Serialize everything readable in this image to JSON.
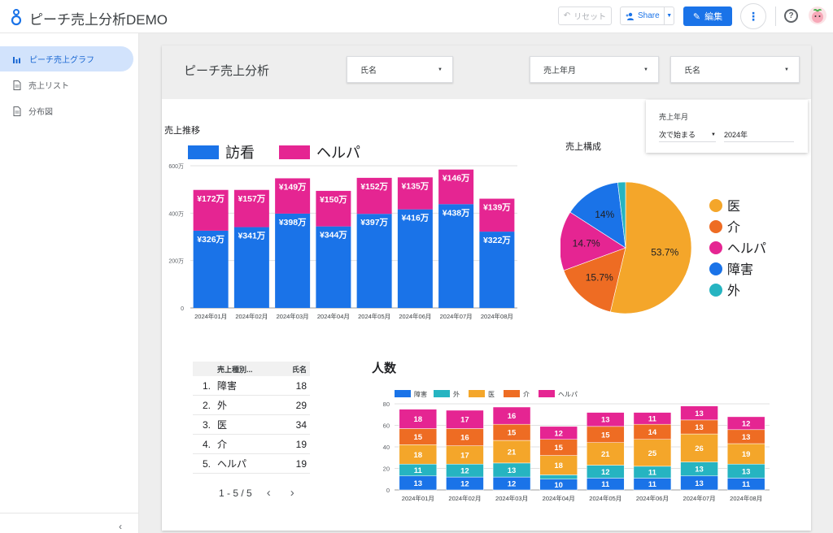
{
  "app": {
    "title": "ピーチ売上分析DEMO",
    "reset_label": "リセット",
    "share_label": "Share",
    "edit_label": "編集",
    "more_label": "⋮",
    "help_label": "?"
  },
  "sidebar": {
    "items": [
      {
        "label": "ピーチ売上グラフ",
        "active": true,
        "icon": "bar-chart-icon"
      },
      {
        "label": "売上リスト",
        "active": false,
        "icon": "document-icon"
      },
      {
        "label": "分布図",
        "active": false,
        "icon": "document-icon"
      }
    ],
    "collapse_label": "‹"
  },
  "report": {
    "title": "ピーチ売上分析",
    "filters": [
      {
        "label": "氏名"
      },
      {
        "label": "売上年月"
      },
      {
        "label": "氏名"
      }
    ],
    "date_popup": {
      "label": "売上年月",
      "mode": "次で始まる",
      "value": "2024年"
    }
  },
  "colors": {
    "houkan": "#1a73e8",
    "helper": "#e52592",
    "i": "#f4a62a",
    "kai": "#ee6c23",
    "shogai": "#1a73e8",
    "soto": "#26b4c1"
  },
  "chart_data": [
    {
      "type": "bar",
      "stacked": true,
      "title": "売上推移",
      "categories": [
        "2024年01月",
        "2024年02月",
        "2024年03月",
        "2024年04月",
        "2024年05月",
        "2024年06月",
        "2024年07月",
        "2024年08月"
      ],
      "series": [
        {
          "name": "訪看",
          "values": [
            326,
            341,
            398,
            344,
            397,
            416,
            438,
            322
          ],
          "labels": [
            "¥326万",
            "¥341万",
            "¥398万",
            "¥344万",
            "¥397万",
            "¥416万",
            "¥438万",
            "¥322万"
          ],
          "color": "#1a73e8"
        },
        {
          "name": "ヘルパ",
          "values": [
            172,
            157,
            149,
            150,
            152,
            135,
            146,
            139
          ],
          "labels": [
            "¥172万",
            "¥157万",
            "¥149万",
            "¥150万",
            "¥152万",
            "¥135万",
            "¥146万",
            "¥139万"
          ],
          "color": "#e52592"
        }
      ],
      "yticks": [
        "0",
        "200万",
        "400万",
        "600万"
      ],
      "ytick_values": [
        0,
        200,
        400,
        600
      ],
      "ylim": [
        0,
        600
      ],
      "legend": "top-left"
    },
    {
      "type": "pie",
      "title": "売上構成",
      "slices": [
        {
          "name": "医",
          "value": 53.7,
          "label": "53.7%",
          "color": "#f4a62a"
        },
        {
          "name": "介",
          "value": 15.7,
          "label": "15.7%",
          "color": "#ee6c23"
        },
        {
          "name": "ヘルパ",
          "value": 14.7,
          "label": "14.7%",
          "color": "#e52592"
        },
        {
          "name": "障害",
          "value": 14.0,
          "label": "14%",
          "color": "#1a73e8"
        },
        {
          "name": "外",
          "value": 1.9,
          "label": "",
          "color": "#26b4c1"
        }
      ],
      "legend": "right"
    },
    {
      "type": "table",
      "columns": [
        "売上種別...",
        "氏名"
      ],
      "rows": [
        {
          "idx": "1.",
          "type": "障害",
          "count": "18"
        },
        {
          "idx": "2.",
          "type": "外",
          "count": "29"
        },
        {
          "idx": "3.",
          "type": "医",
          "count": "34"
        },
        {
          "idx": "4.",
          "type": "介",
          "count": "19"
        },
        {
          "idx": "5.",
          "type": "ヘルパ",
          "count": "19"
        }
      ],
      "pager": "1 - 5 / 5"
    },
    {
      "type": "bar",
      "stacked": true,
      "title": "人数",
      "categories": [
        "2024年01月",
        "2024年02月",
        "2024年03月",
        "2024年04月",
        "2024年05月",
        "2024年06月",
        "2024年07月",
        "2024年08月"
      ],
      "series": [
        {
          "name": "障害",
          "values": [
            13,
            12,
            12,
            10,
            11,
            11,
            13,
            11
          ],
          "color": "#1a73e8"
        },
        {
          "name": "外",
          "values": [
            11,
            12,
            13,
            4,
            12,
            11,
            13,
            13
          ],
          "color": "#26b4c1"
        },
        {
          "name": "医",
          "values": [
            18,
            17,
            21,
            18,
            21,
            25,
            26,
            19
          ],
          "color": "#f4a62a"
        },
        {
          "name": "介",
          "values": [
            15,
            16,
            15,
            15,
            15,
            14,
            13,
            13
          ],
          "color": "#ee6c23"
        },
        {
          "name": "ヘルパ",
          "values": [
            18,
            17,
            16,
            12,
            13,
            11,
            13,
            12
          ],
          "color": "#e52592"
        }
      ],
      "yticks": [
        "0",
        "20",
        "40",
        "60",
        "80"
      ],
      "ytick_values": [
        0,
        20,
        40,
        60,
        80
      ],
      "ylim": [
        0,
        80
      ],
      "legend": "top-left"
    }
  ]
}
